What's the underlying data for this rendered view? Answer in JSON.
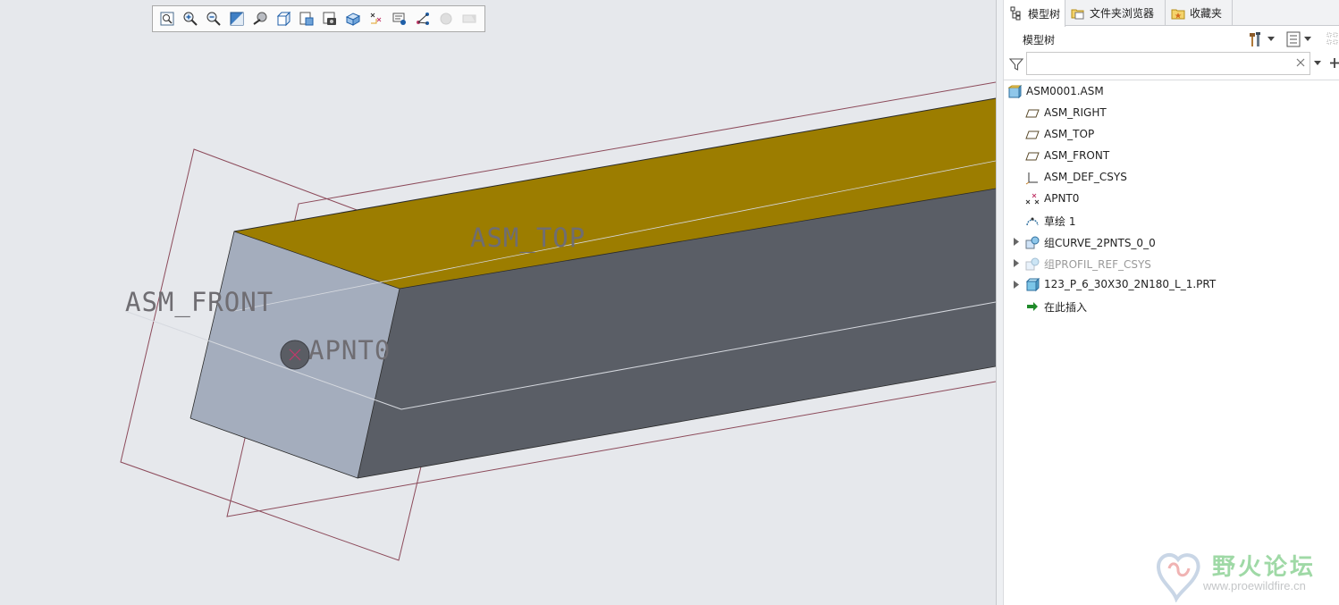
{
  "viewport": {
    "datum_labels": {
      "front": "ASM_FRONT",
      "top": "ASM_TOP",
      "point": "APNT0"
    },
    "colors": {
      "background": "#e6e8ec",
      "top_face": "#9c7d00",
      "side_face": "#5a5e66",
      "end_face": "#a4adbd",
      "datum_plane": "#8c4a5a",
      "datum_label": "#6f6d72"
    }
  },
  "graphics_toolbar": {
    "buttons": [
      {
        "name": "refit-icon",
        "enabled": true
      },
      {
        "name": "zoom-in-icon",
        "enabled": true
      },
      {
        "name": "zoom-out-icon",
        "enabled": true
      },
      {
        "name": "repaint-icon",
        "enabled": true
      },
      {
        "name": "spin-center-icon",
        "enabled": true
      },
      {
        "name": "display-style-icon",
        "enabled": true
      },
      {
        "name": "saved-orientations-icon",
        "enabled": true
      },
      {
        "name": "view-manager-icon",
        "enabled": true
      },
      {
        "name": "perspective-view-icon",
        "enabled": true
      },
      {
        "name": "datum-display-filters-icon",
        "enabled": true
      },
      {
        "name": "annotation-display-icon",
        "enabled": true
      },
      {
        "name": "model-display-icon",
        "enabled": true
      },
      {
        "name": "appearance-icon",
        "enabled": false
      },
      {
        "name": "measure-icon",
        "enabled": false
      }
    ]
  },
  "side_panel": {
    "tabs": [
      {
        "label": "模型树",
        "icon": "model-tree-icon",
        "active": true
      },
      {
        "label": "文件夹浏览器",
        "icon": "folder-browser-icon",
        "active": false
      },
      {
        "label": "收藏夹",
        "icon": "favorites-icon",
        "active": false
      }
    ],
    "tree_title": "模型树",
    "search": {
      "value": "",
      "placeholder": ""
    },
    "tree": [
      {
        "label": "ASM0001.ASM",
        "icon": "assembly-icon",
        "level": 0,
        "expander": false,
        "dim": false
      },
      {
        "label": "ASM_RIGHT",
        "icon": "datum-plane-icon",
        "level": 1,
        "expander": false,
        "dim": false
      },
      {
        "label": "ASM_TOP",
        "icon": "datum-plane-icon",
        "level": 1,
        "expander": false,
        "dim": false
      },
      {
        "label": "ASM_FRONT",
        "icon": "datum-plane-icon",
        "level": 1,
        "expander": false,
        "dim": false
      },
      {
        "label": "ASM_DEF_CSYS",
        "icon": "coordinate-system-icon",
        "level": 1,
        "expander": false,
        "dim": false
      },
      {
        "label": "APNT0",
        "icon": "datum-point-icon",
        "level": 1,
        "expander": false,
        "dim": false
      },
      {
        "label": "草绘 1",
        "icon": "sketch-icon",
        "level": 1,
        "expander": false,
        "dim": false
      },
      {
        "label": "组CURVE_2PNTS_0_0",
        "icon": "group-icon",
        "level": 1,
        "expander": true,
        "dim": false
      },
      {
        "label": "组PROFIL_REF_CSYS",
        "icon": "group-icon",
        "level": 1,
        "expander": true,
        "dim": true
      },
      {
        "label": "123_P_6_30X30_2N180_L_1.PRT",
        "icon": "part-icon",
        "level": 1,
        "expander": true,
        "dim": false
      },
      {
        "label": "在此插入",
        "icon": "insert-here-arrow-icon",
        "level": 1,
        "expander": false,
        "dim": false
      }
    ]
  },
  "watermark": {
    "text": "野火论坛",
    "url": "www.proewildfire.cn"
  }
}
